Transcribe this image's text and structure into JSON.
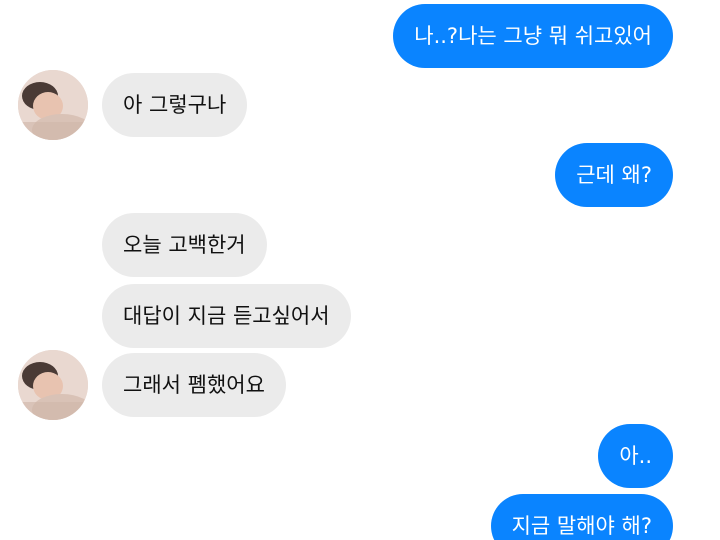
{
  "messages": [
    {
      "side": "outgoing",
      "text": "나..?나는 그냥 뭐 쉬고있어"
    },
    {
      "side": "incoming",
      "text": "아 그렇구나"
    },
    {
      "side": "outgoing",
      "text": "근데 왜?"
    },
    {
      "side": "incoming",
      "text": "오늘 고백한거"
    },
    {
      "side": "incoming",
      "text": "대답이 지금 듣고싶어서"
    },
    {
      "side": "incoming",
      "text": "그래서 폠했어요"
    },
    {
      "side": "outgoing",
      "text": "아.."
    },
    {
      "side": "outgoing",
      "text": "지금 말해야 해?"
    }
  ],
  "colors": {
    "outgoing_bubble": "#0a84ff",
    "incoming_bubble": "#ebebeb",
    "background": "#ffffff"
  },
  "icons": {
    "avatar": "contact-avatar-photo"
  }
}
